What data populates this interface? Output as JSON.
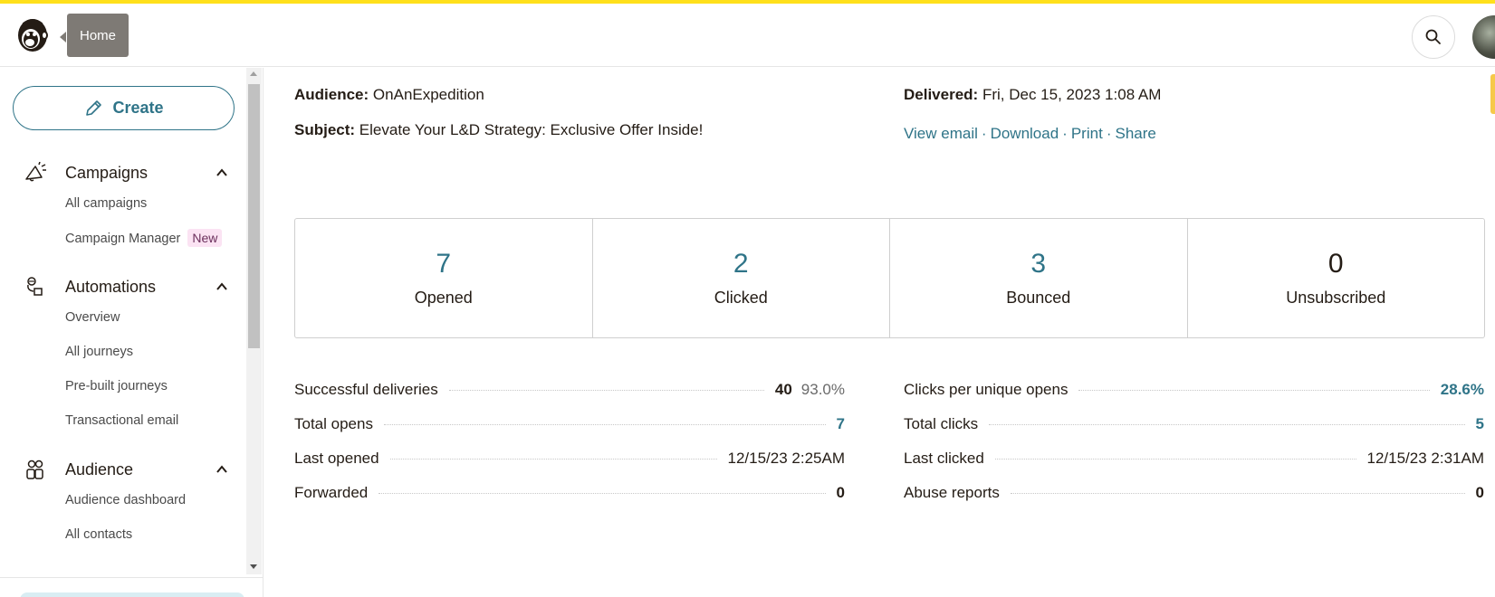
{
  "header": {
    "tooltip": "Home",
    "icons": {
      "logo": "freddie-logo-icon",
      "search": "search-icon",
      "avatar": "user-avatar"
    }
  },
  "colors": {
    "accent_yellow": "#ffe01b",
    "teal": "#2f7488",
    "tooltip_bg": "#7e7a75",
    "new_badge_bg": "#fbe3f3"
  },
  "sidebar": {
    "create_label": "Create",
    "sections": [
      {
        "label": "Campaigns",
        "icon": "megaphone-icon",
        "items": [
          {
            "label": "All campaigns"
          },
          {
            "label": "Campaign Manager",
            "badge": "New"
          }
        ]
      },
      {
        "label": "Automations",
        "icon": "automation-icon",
        "items": [
          {
            "label": "Overview"
          },
          {
            "label": "All journeys"
          },
          {
            "label": "Pre-built journeys"
          },
          {
            "label": "Transactional email"
          }
        ]
      },
      {
        "label": "Audience",
        "icon": "audience-icon",
        "items": [
          {
            "label": "Audience dashboard"
          },
          {
            "label": "All contacts"
          }
        ]
      }
    ]
  },
  "report": {
    "audience_label": "Audience:",
    "audience_value": "OnAnExpedition",
    "subject_label": "Subject:",
    "subject_value": "Elevate Your L&D Strategy: Exclusive Offer Inside!",
    "delivered_label": "Delivered:",
    "delivered_value": "Fri, Dec 15, 2023 1:08 AM",
    "links": [
      "View email",
      "Download",
      "Print",
      "Share"
    ],
    "link_separator": "·"
  },
  "stats": [
    {
      "value": "7",
      "label": "Opened"
    },
    {
      "value": "2",
      "label": "Clicked"
    },
    {
      "value": "3",
      "label": "Bounced"
    },
    {
      "value": "0",
      "label": "Unsubscribed"
    }
  ],
  "details_left": [
    {
      "label": "Successful deliveries",
      "value": "40",
      "extra": "93.0%"
    },
    {
      "label": "Total opens",
      "value": "7"
    },
    {
      "label": "Last opened",
      "value": "12/15/23 2:25AM"
    },
    {
      "label": "Forwarded",
      "value": "0"
    }
  ],
  "details_right": [
    {
      "label": "Clicks per unique opens",
      "value": "28.6%"
    },
    {
      "label": "Total clicks",
      "value": "5"
    },
    {
      "label": "Last clicked",
      "value": "12/15/23 2:31AM"
    },
    {
      "label": "Abuse reports",
      "value": "0"
    }
  ]
}
